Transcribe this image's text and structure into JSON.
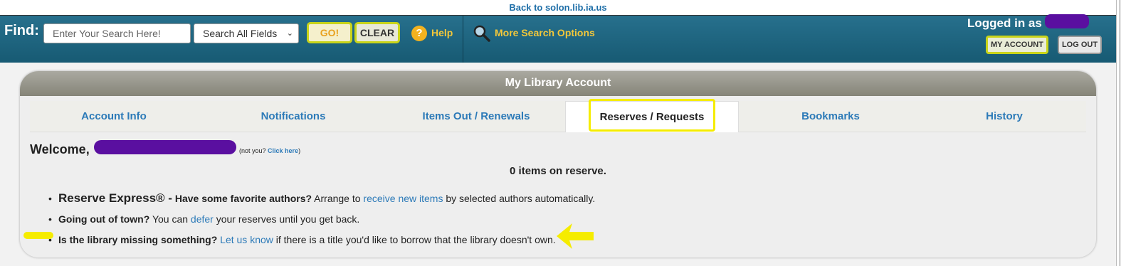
{
  "top_link": "Back to solon.lib.ia.us",
  "header": {
    "find_label": "Find:",
    "search_placeholder": "Enter Your Search Here!",
    "field_select": "Search All Fields",
    "go_label": "GO!",
    "clear_label": "CLEAR",
    "help_label": "Help",
    "more_options": "More Search Options",
    "logged_in": "Logged in as",
    "my_account": "MY ACCOUNT",
    "log_out": "LOG OUT"
  },
  "panel": {
    "title": "My Library Account",
    "tabs": [
      {
        "label": "Account Info"
      },
      {
        "label": "Notifications"
      },
      {
        "label": "Items Out / Renewals"
      },
      {
        "label": "Reserves / Requests"
      },
      {
        "label": "Bookmarks"
      },
      {
        "label": "History"
      }
    ],
    "welcome": "Welcome,",
    "not_you": "(not you?",
    "click_here": "Click here",
    "not_you_close": ")",
    "reserve_count": "0 items on reserve.",
    "bullets": [
      {
        "lead": "Reserve Express® -",
        "bold": "Have some favorite authors?",
        "pre": "Arrange to",
        "link": "receive new items",
        "post": "by selected authors automatically."
      },
      {
        "bold": "Going out of town?",
        "pre": "You can",
        "link": "defer",
        "post": "your reserves until you get back."
      },
      {
        "bold": "Is the library missing something?",
        "link": "Let us know",
        "post": "if there is a title you'd like to borrow that the library doesn't own."
      }
    ]
  },
  "colors": {
    "header": "#1d6480",
    "link": "#2c7ab8",
    "highlight": "#f5ec00",
    "redaction": "#5a0fa0"
  }
}
